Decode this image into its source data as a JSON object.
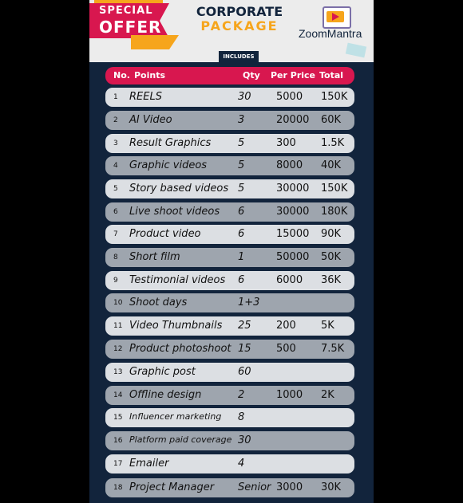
{
  "offer": {
    "small": "SPECIAL",
    "big": "OFFER"
  },
  "title": {
    "line1": "CORPORATE",
    "line2": "PACKAGE"
  },
  "brand": "ZoomMantra",
  "includes": "INCLUDES",
  "headers": {
    "no": "No.",
    "points": "Points",
    "qty": "Qty",
    "price": "Per Price",
    "total": "Total"
  },
  "colors": {
    "accent": "#d8174f",
    "gold": "#f6a51c",
    "navy": "#12243c"
  },
  "rows": [
    {
      "no": "1",
      "point": "REELS",
      "qty": "30",
      "price": "5000",
      "total": "150K"
    },
    {
      "no": "2",
      "point": "AI Video",
      "qty": "3",
      "price": "20000",
      "total": "60K"
    },
    {
      "no": "3",
      "point": "Result Graphics",
      "qty": "5",
      "price": "300",
      "total": "1.5K"
    },
    {
      "no": "4",
      "point": "Graphic videos",
      "qty": "5",
      "price": "8000",
      "total": "40K"
    },
    {
      "no": "5",
      "point": "Story based videos",
      "qty": "5",
      "price": "30000",
      "total": "150K"
    },
    {
      "no": "6",
      "point": "Live shoot videos",
      "qty": "6",
      "price": "30000",
      "total": "180K"
    },
    {
      "no": "7",
      "point": "Product video",
      "qty": "6",
      "price": "15000",
      "total": "90K"
    },
    {
      "no": "8",
      "point": "Short film",
      "qty": "1",
      "price": "50000",
      "total": "50K"
    },
    {
      "no": "9",
      "point": "Testimonial videos",
      "qty": "6",
      "price": "6000",
      "total": "36K"
    },
    {
      "no": "10",
      "point": "Shoot days",
      "qty": "1+3",
      "price": "",
      "total": ""
    },
    {
      "no": "11",
      "point": "Video Thumbnails",
      "qty": "25",
      "price": "200",
      "total": "5K"
    },
    {
      "no": "12",
      "point": "Product photoshoot",
      "qty": "15",
      "price": "500",
      "total": "7.5K"
    },
    {
      "no": "13",
      "point": "Graphic post",
      "qty": "60",
      "price": "",
      "total": ""
    },
    {
      "no": "14",
      "point": "Offline design",
      "qty": "2",
      "price": "1000",
      "total": "2K"
    },
    {
      "no": "15",
      "point": "Influencer marketing",
      "qty": "8",
      "price": "",
      "total": ""
    },
    {
      "no": "16",
      "point": "Platform paid coverage",
      "qty": "30",
      "price": "",
      "total": ""
    },
    {
      "no": "17",
      "point": "Emailer",
      "qty": "4",
      "price": "",
      "total": ""
    },
    {
      "no": "18",
      "point": "Project Manager",
      "qty": "Senior",
      "price": "3000",
      "total": "30K"
    }
  ]
}
